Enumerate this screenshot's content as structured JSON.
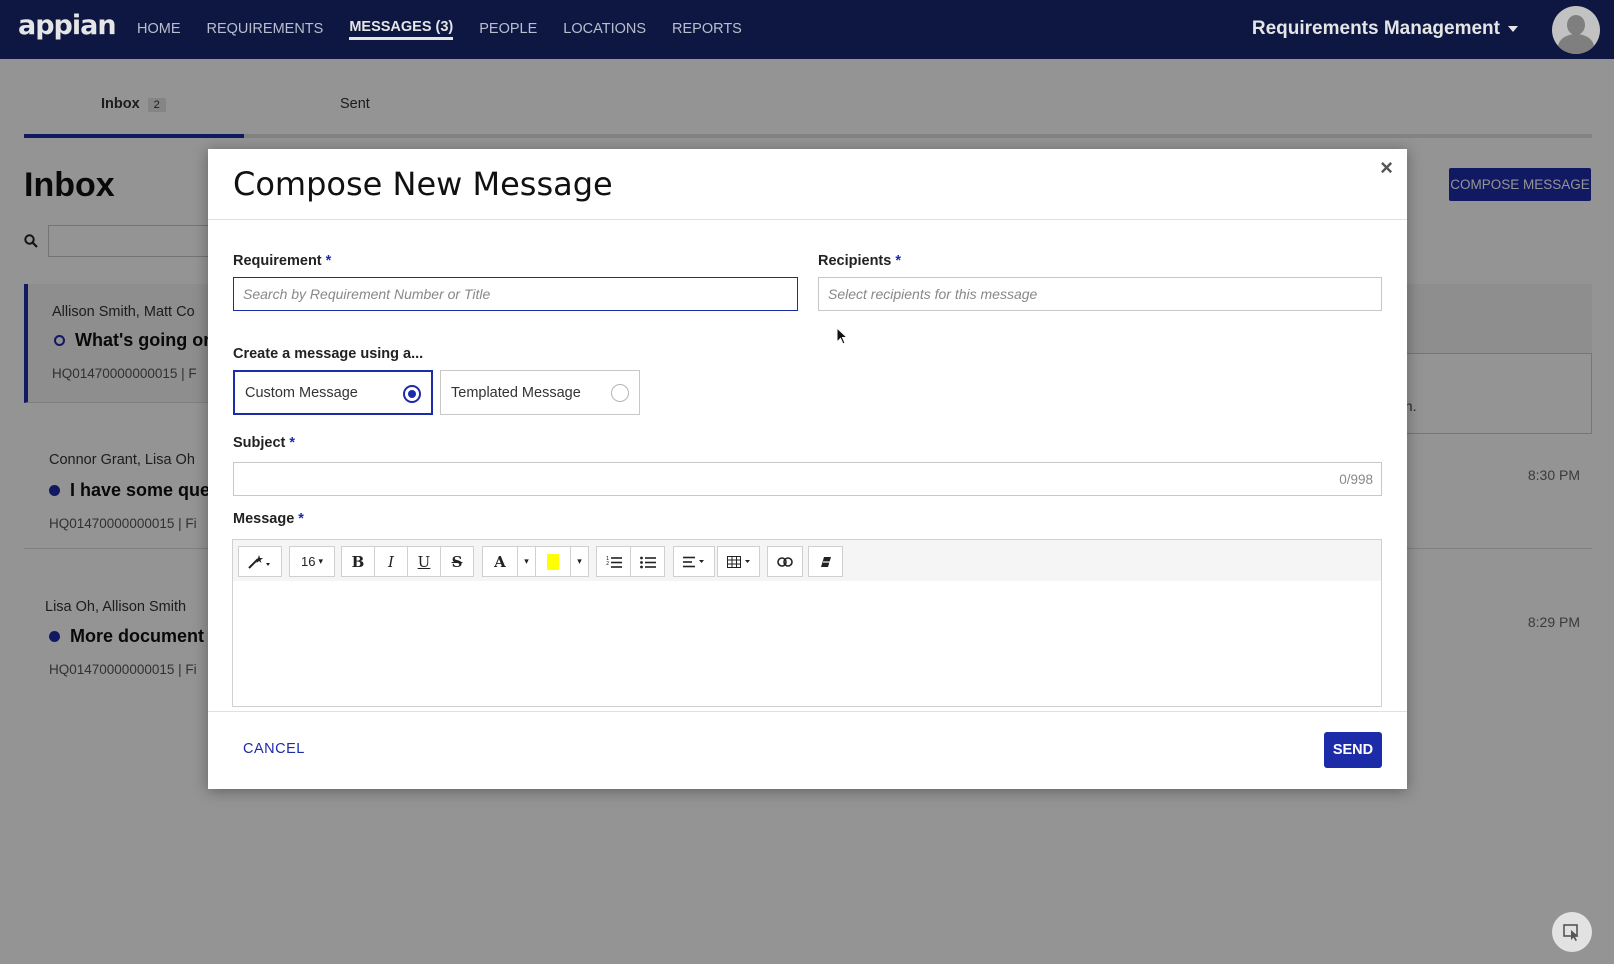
{
  "nav": {
    "logo": "appian",
    "links": [
      "HOME",
      "REQUIREMENTS",
      "MESSAGES (3)",
      "PEOPLE",
      "LOCATIONS",
      "REPORTS"
    ],
    "active_index": 2,
    "app_name": "Requirements Management"
  },
  "page": {
    "tabs": {
      "inbox_label": "Inbox",
      "inbox_count": "2",
      "sent_label": "Sent"
    },
    "title": "Inbox",
    "compose_label": "COMPOSE MESSAGE",
    "messages": [
      {
        "from": "Allison Smith, Matt Co",
        "subject": "What's going or",
        "ref": "HQ01470000000015 | F",
        "time": "",
        "unread": false
      },
      {
        "from": "Connor Grant, Lisa Oh",
        "subject": "I have some que",
        "ref": "HQ01470000000015 | Fi",
        "time": "8:30 PM",
        "unread": true
      },
      {
        "from": "Lisa Oh, Allison Smith",
        "subject": "More document",
        "ref": "HQ01470000000015 | Fi",
        "time": "8:29 PM",
        "unread": true
      }
    ],
    "preview_text": "tion."
  },
  "modal": {
    "title": "Compose New Message",
    "requirement": {
      "label": "Requirement",
      "placeholder": "Search by Requirement Number or Title"
    },
    "recipients": {
      "label": "Recipients",
      "placeholder": "Select recipients for this message"
    },
    "create_using": {
      "label": "Create a message using a...",
      "options": [
        "Custom Message",
        "Templated Message"
      ],
      "selected": "Custom Message"
    },
    "subject": {
      "label": "Subject",
      "value": "",
      "counter": "0/998"
    },
    "message": {
      "label": "Message",
      "font_size": "16"
    },
    "cancel_label": "CANCEL",
    "send_label": "SEND",
    "required_mark": "*"
  },
  "colors": {
    "nav_bg": "#0f1a4a",
    "accent": "#1c2ba8",
    "highlight": "#ffff00"
  }
}
